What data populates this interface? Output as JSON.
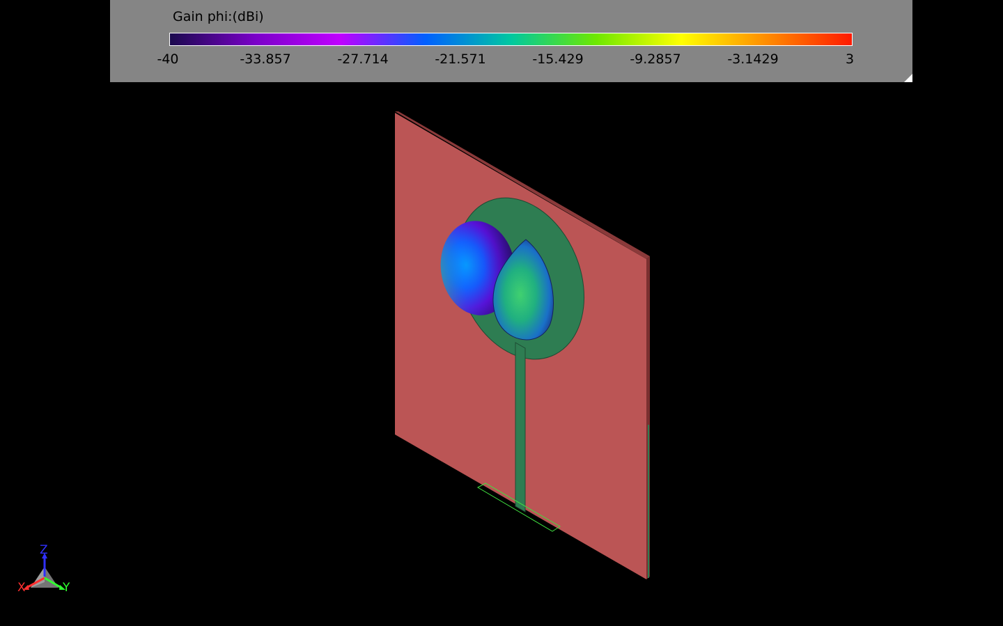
{
  "legend": {
    "title": "Gain phi:(dBi)",
    "colorbar_stops": [
      "#1b0a4e",
      "#7a00c8",
      "#c000ff",
      "#0060ff",
      "#00c8a0",
      "#6ee800",
      "#ffff00",
      "#ff8c00",
      "#ff1a00"
    ],
    "ticks": [
      "-40",
      "-33.857",
      "-27.714",
      "-21.571",
      "-15.429",
      "-9.2857",
      "-3.1429",
      "3"
    ],
    "range": [
      -40,
      3
    ]
  },
  "scene": {
    "substrate_color": "#bb5555",
    "substrate_edge_color": "#8a3a3a",
    "patch_color": "#2e7d52",
    "port_outline_color": "#40e040"
  },
  "axes": {
    "z_label": "Z",
    "x_label": "X",
    "y_label": "Y",
    "z_color": "#3030ff",
    "x_color": "#ff3030",
    "y_color": "#30ff30"
  }
}
